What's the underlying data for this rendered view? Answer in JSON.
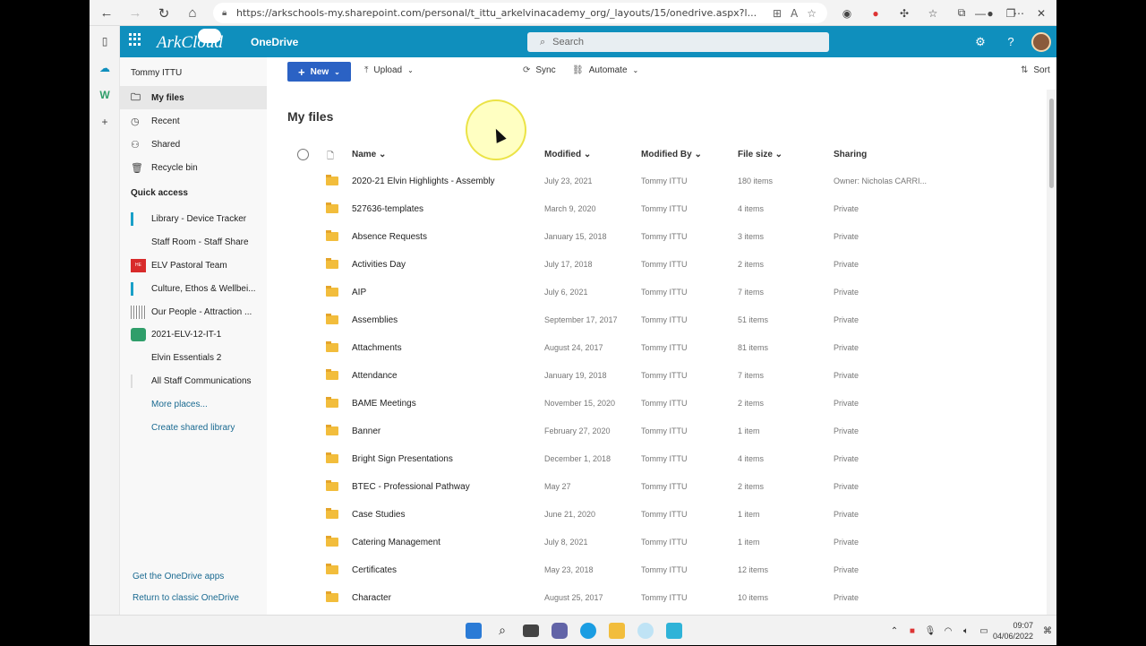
{
  "browser": {
    "url": "https://arkschools-my.sharepoint.com/personal/t_ittu_arkelvinacademy_org/_layouts/15/onedrive.aspx?l...",
    "back_icon": "back-arrow-icon",
    "forward_icon": "forward-arrow-icon",
    "refresh_icon": "refresh-icon",
    "home_icon": "home-icon"
  },
  "suite": {
    "logo": "ArkCloud",
    "app_name": "OneDrive",
    "search_placeholder": "Search"
  },
  "leftnav": {
    "user": "Tommy ITTU",
    "items": [
      {
        "label": "My files",
        "icon": "folder-icon",
        "selected": true
      },
      {
        "label": "Recent",
        "icon": "clock-icon",
        "selected": false
      },
      {
        "label": "Shared",
        "icon": "people-icon",
        "selected": false
      },
      {
        "label": "Recycle bin",
        "icon": "trash-icon",
        "selected": false
      }
    ],
    "quick_access_title": "Quick access",
    "quick_access": [
      {
        "label": "Library - Device Tracker",
        "color": "#1aa0c8"
      },
      {
        "label": "Staff Room - Staff Share",
        "color": "#ffffff"
      },
      {
        "label": "ELV Pastoral Team",
        "color": "#d82b2b",
        "badge": "HE"
      },
      {
        "label": "Culture, Ethos & Wellbei...",
        "color": "#1aa0c8"
      },
      {
        "label": "Our People - Attraction ...",
        "color": "#888888"
      },
      {
        "label": "2021-ELV-12-IT-1",
        "color": "#2f9e6a"
      },
      {
        "label": "Elvin Essentials 2",
        "color": "#ffffff"
      },
      {
        "label": "All Staff Communications",
        "color": "#dddddd"
      }
    ],
    "more_places": "More places...",
    "create_shared": "Create shared library",
    "get_apps": "Get the OneDrive apps",
    "return_classic": "Return to classic OneDrive"
  },
  "cmdbar": {
    "new": "New",
    "upload": "Upload",
    "sync": "Sync",
    "automate": "Automate",
    "sort": "Sort"
  },
  "page_title": "My files",
  "columns": {
    "name": "Name",
    "modified": "Modified",
    "modified_by": "Modified By",
    "file_size": "File size",
    "sharing": "Sharing"
  },
  "files": [
    {
      "name": "2020-21 Elvin Highlights - Assembly",
      "modified": "July 23, 2021",
      "by": "Tommy ITTU",
      "size": "180 items",
      "sharing": "Owner: Nicholas CARRI..."
    },
    {
      "name": "527636-templates",
      "modified": "March 9, 2020",
      "by": "Tommy ITTU",
      "size": "4 items",
      "sharing": "Private"
    },
    {
      "name": "Absence Requests",
      "modified": "January 15, 2018",
      "by": "Tommy ITTU",
      "size": "3 items",
      "sharing": "Private"
    },
    {
      "name": "Activities Day",
      "modified": "July 17, 2018",
      "by": "Tommy ITTU",
      "size": "2 items",
      "sharing": "Private"
    },
    {
      "name": "AIP",
      "modified": "July 6, 2021",
      "by": "Tommy ITTU",
      "size": "7 items",
      "sharing": "Private"
    },
    {
      "name": "Assemblies",
      "modified": "September 17, 2017",
      "by": "Tommy ITTU",
      "size": "51 items",
      "sharing": "Private"
    },
    {
      "name": "Attachments",
      "modified": "August 24, 2017",
      "by": "Tommy ITTU",
      "size": "81 items",
      "sharing": "Private"
    },
    {
      "name": "Attendance",
      "modified": "January 19, 2018",
      "by": "Tommy ITTU",
      "size": "7 items",
      "sharing": "Private"
    },
    {
      "name": "BAME Meetings",
      "modified": "November 15, 2020",
      "by": "Tommy ITTU",
      "size": "2 items",
      "sharing": "Private"
    },
    {
      "name": "Banner",
      "modified": "February 27, 2020",
      "by": "Tommy ITTU",
      "size": "1 item",
      "sharing": "Private"
    },
    {
      "name": "Bright Sign Presentations",
      "modified": "December 1, 2018",
      "by": "Tommy ITTU",
      "size": "4 items",
      "sharing": "Private"
    },
    {
      "name": "BTEC - Professional Pathway",
      "modified": "May 27",
      "by": "Tommy ITTU",
      "size": "2 items",
      "sharing": "Private"
    },
    {
      "name": "Case Studies",
      "modified": "June 21, 2020",
      "by": "Tommy ITTU",
      "size": "1 item",
      "sharing": "Private"
    },
    {
      "name": "Catering Management",
      "modified": "July 8, 2021",
      "by": "Tommy ITTU",
      "size": "1 item",
      "sharing": "Private"
    },
    {
      "name": "Certificates",
      "modified": "May 23, 2018",
      "by": "Tommy ITTU",
      "size": "12 items",
      "sharing": "Private"
    },
    {
      "name": "Character",
      "modified": "August 25, 2017",
      "by": "Tommy ITTU",
      "size": "10 items",
      "sharing": "Private"
    }
  ],
  "taskbar": {
    "time": "09:07",
    "date": "04/06/2022"
  },
  "colors": {
    "suitebar": "#0f8fbd",
    "primary": "#2b62c4",
    "folder": "#f2bd3c",
    "link": "#1a6a91"
  }
}
